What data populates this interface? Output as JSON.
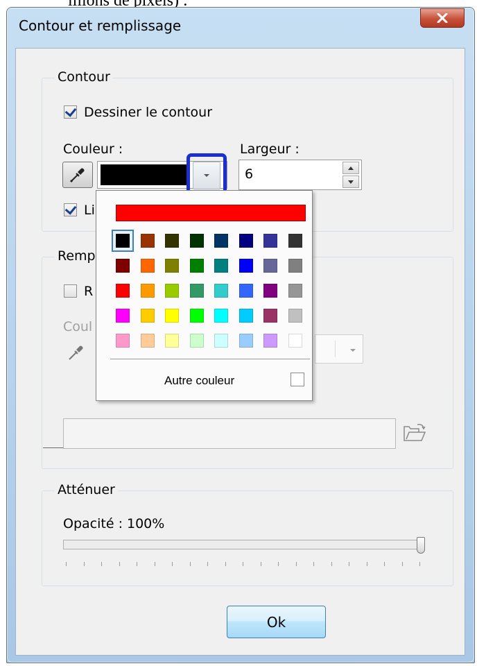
{
  "page_caption": "illions de pixels) :",
  "dialog": {
    "title": "Contour et remplissage",
    "close_label": "X"
  },
  "contour": {
    "group_label": "Contour",
    "draw_outline_label": "Dessiner le contour",
    "draw_outline_checked": true,
    "color_label": "Couleur :",
    "width_label": "Largeur :",
    "width_value": "6",
    "selected_color": "#000000",
    "second_checkbox_label_visible": "Li",
    "second_checkbox_checked": true
  },
  "remplissage": {
    "group_label_visible": "Remp",
    "checkbox_label_visible": "R",
    "checkbox_checked": false,
    "color_label_visible": "Coul"
  },
  "attenuer": {
    "group_label": "Atténuer",
    "opacity_label": "Opacité : 100%",
    "opacity_value": 100
  },
  "ok_label": "Ok",
  "color_popup": {
    "recent_color": "#ff0000",
    "grid": [
      [
        "#000000",
        "#993300",
        "#333300",
        "#003300",
        "#003366",
        "#000080",
        "#333399",
        "#333333"
      ],
      [
        "#800000",
        "#ff6600",
        "#808000",
        "#008000",
        "#008080",
        "#0000ff",
        "#666699",
        "#808080"
      ],
      [
        "#ff0000",
        "#ff9900",
        "#99cc00",
        "#339966",
        "#33cccc",
        "#3366ff",
        "#800080",
        "#969696"
      ],
      [
        "#ff00ff",
        "#ffcc00",
        "#ffff00",
        "#00ff00",
        "#00ffff",
        "#00ccff",
        "#993366",
        "#c0c0c0"
      ],
      [
        "#ff99cc",
        "#ffcc99",
        "#ffff99",
        "#ccffcc",
        "#ccffff",
        "#99ccff",
        "#cc99ff",
        "#ffffff"
      ]
    ],
    "selected_index": [
      0,
      0
    ],
    "other_color_label": "Autre couleur"
  },
  "colors": {
    "highlight": "#1b2fd1",
    "selection_ring": "#3d7fc4"
  }
}
